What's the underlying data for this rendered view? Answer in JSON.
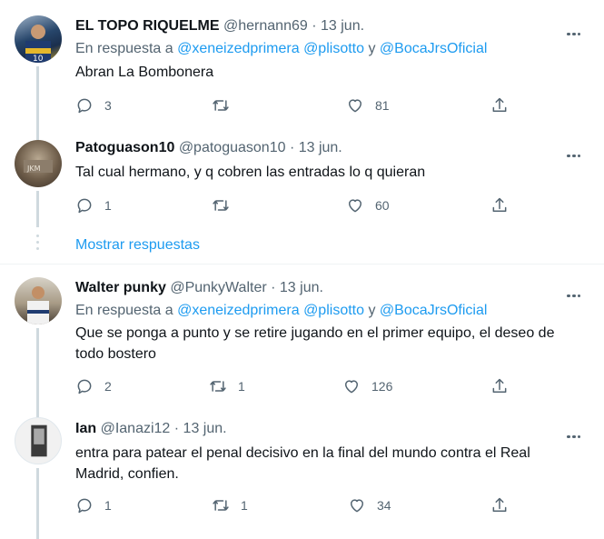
{
  "colors": {
    "link": "#1d9bf0",
    "secondary": "#536471",
    "primary_text": "#0f1419"
  },
  "reply_to_prefix": "En respuesta a",
  "reply_to_and": "y",
  "show_replies": "Mostrar respuestas",
  "tweets": [
    {
      "name": "EL TOPO RIQUELME",
      "handle": "@hernann69",
      "date": "· 13 jun.",
      "mentions": [
        "@xeneizedprimera",
        "@plisotto",
        "@BocaJrsOficial"
      ],
      "text": "Abran La Bombonera",
      "replies": "3",
      "retweets": "",
      "likes": "81"
    },
    {
      "name": "Patoguason10",
      "handle": "@patoguason10",
      "date": "· 13 jun.",
      "text": "Tal cual hermano, y q cobren las entradas lo q quieran",
      "replies": "1",
      "retweets": "",
      "likes": "60"
    },
    {
      "name": "Walter punky",
      "handle": "@PunkyWalter",
      "date": "· 13 jun.",
      "mentions": [
        "@xeneizedprimera",
        "@plisotto",
        "@BocaJrsOficial"
      ],
      "text": "Que se ponga a punto y se retire jugando en el primer equipo, el deseo de todo bostero",
      "replies": "2",
      "retweets": "1",
      "likes": "126"
    },
    {
      "name": "Ian",
      "handle": "@Ianazi12",
      "date": "· 13 jun.",
      "text": "entra para patear el penal decisivo en la final del mundo contra el Real Madrid, confien.",
      "replies": "1",
      "retweets": "1",
      "likes": "34"
    }
  ]
}
